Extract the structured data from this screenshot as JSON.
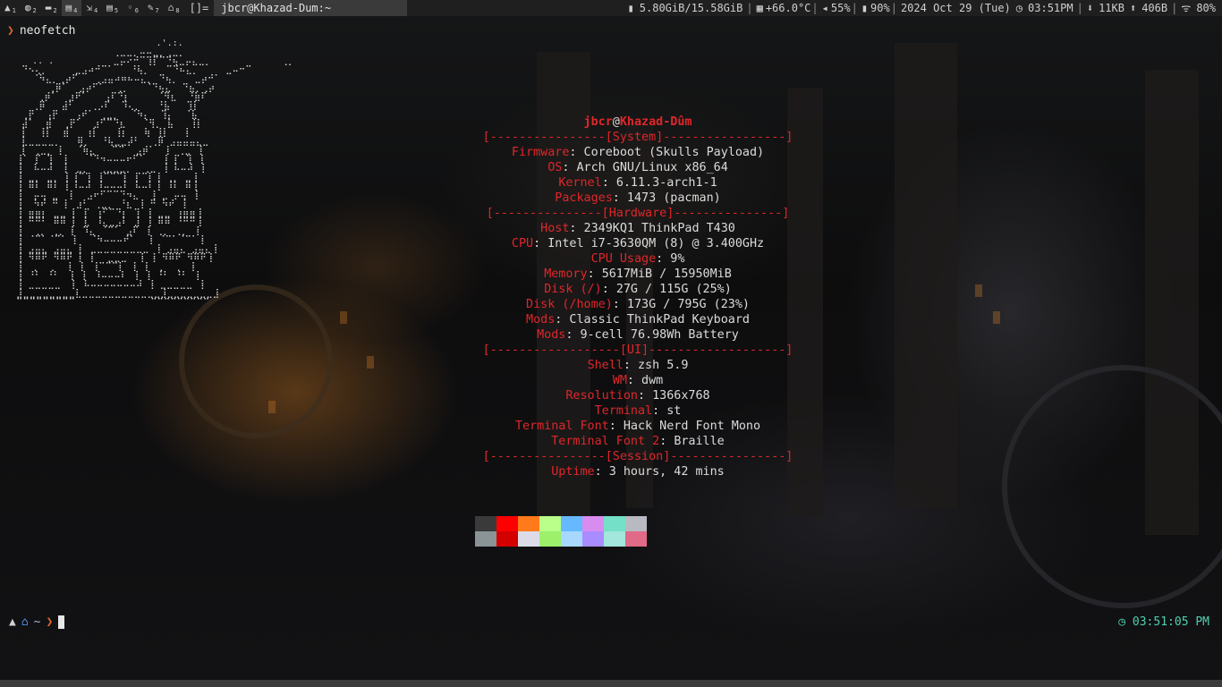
{
  "topbar": {
    "tags": [
      {
        "icon": "arch-icon",
        "glyph": "▲",
        "num": "1",
        "selected": false
      },
      {
        "icon": "globe-icon",
        "glyph": "◍",
        "num": "2",
        "selected": false
      },
      {
        "icon": "folder-icon",
        "glyph": "▬",
        "num": "2",
        "selected": false
      },
      {
        "icon": "files-icon",
        "glyph": "▤",
        "num": "4",
        "selected": true
      },
      {
        "icon": "code-icon",
        "glyph": "⇲",
        "num": "4",
        "selected": false
      },
      {
        "icon": "doc-icon",
        "glyph": "▤",
        "num": "5",
        "selected": false
      },
      {
        "icon": "circle-icon",
        "glyph": "◦",
        "num": "6",
        "selected": false
      },
      {
        "icon": "tools-icon",
        "glyph": "✎",
        "num": "7",
        "selected": false
      },
      {
        "icon": "flask-icon",
        "glyph": "⌂",
        "num": "8",
        "selected": false
      }
    ],
    "layout": "[]=",
    "window_title": "jbcr@Khazad-Dum:~",
    "status": {
      "memory": "5.80GiB/15.58GiB",
      "temp": "+66.0°C",
      "volume": "55%",
      "battery": "90%",
      "date": "2024 Oct 29 (Tue)",
      "time": "03:51PM",
      "download": "11KB",
      "upload": "406B",
      "wifi": "80%"
    }
  },
  "terminal": {
    "command": "neofetch",
    "ascii_art": "                           .'.:.\n                   ⢀⣀⣀⡀⠤⠤⣀⡀⢀⣀⡀\n    .. .           ⣀⡤⠔⠚⠉⢹⡏⠉⠙⢦⣀⡤⣄⣀⡀             ⢀⡀\n  ⠙⠢⢄⡀     ⣀⣠⠴⠚⠉⠁   ⠘⢧⡀   ⠉⠙⠦⣄⡀     ⣀⠤⠒⠉\n    ⠈⠳⣄⡀⢀⡴⠋   ⢀⣠⣤⠴⠶⠦⠤⣄⡀ ⠙⢦⡀   ⣀⡴⠚⠁\n       ⢀⡿⠁  ⣠⡴⠋⠁  ⢀⡀   ⠈⠙⢦⣄  ⠙⣦⡀⢀⡴\n     ⢀⡾⠁  ⣰⠟⠁   ⢠⠏⠙⡆     ⠈⠻⣆  ⠘⣷⠏\n    ⢀⡿   ⣼⠃   ⢀⡠⠏  ⠹⢄⡀   ⠘⣧   ⢹⡇\n  ⢀⡟  ⢠⡟   ⢠⠞⠁ ⢀⣀⡀  ⠈⠳⡄  ⢹⡄  ⠈⣧\n  ⣼⠁  ⣾  ⢀⡟⠁  ⣰⠋⠉⠙⣆   ⠈⢻⡀ ⣧   ⢸⡇\n  ⡇  ⢸⡇  ⣾   ⢰⡇   ⢸⡆   ⢷ ⢸⡇   ⡇\n  ⣇⣀⣀⣀⣀⡀   ⢿⡀  ⠘⢧⣀⣀⡼⠃  ⢀⡿ ⣠⣤⣤⣤⣄⣀\n  ⡇ ⢀⣀⡀ ⡇  ⠈⢷⣄   ⠉⠉  ⣠⡾⠁  ⡇ ⢀⣀ ⢸\n ⢸⠁ ⡏ ⢹  ⡇   ⠈⠙⠲⠤⠤⠤⠖⠋⠁   ⢸ ⡏ ⢹ ⢸\n ⢸  ⠧⠤⠼  ⡇ ⣀⡀  ⢀⣀⣀⣀⡀  ⢀⣀ ⢸ ⠧⠤⠼ ⢸\n ⢸ ⣀⡀ ⣀⡀ ⡇⢸⠉⢹ ⢸⠉⠉⠉⡇ ⡏⠉⡇⢸ ⢀⡀ ⣀⢸\n ⢸ ⠿⠇ ⠿⠇ ⡇⠸⠤⠼ ⠸⠤⠤⠤⠇ ⠧⠤⠇⢸ ⠸⠇ ⠿⢸\n ⢸  ⡤⢤ ⣀  ⡇  ⣠⠖⠋⠉⠉⠙⠲⣄  ⢸ ⣀ ⡤⢤ ⢸\n ⢸  ⠳⠞ ⠛ ⡇ ⣰⠃ ⢀⣀⡀ ⠘⣆ ⢸ ⠛ ⠳⠞ ⢸\n ⢸ ⣶⣶⡆ ⣀⣀ ⡇ ⡏ ⢰⠋⠉⠙⡆ ⢹ ⢸ ⣀⣀ ⢰⣶⣶⢸\n ⢸ ⠛⠛⠃ ⠿⠿ ⡇ ⣇ ⠸⣄⣀⣠⠇ ⣸ ⢸ ⠿⠿ ⠘⠛⠛⢸\n ⢸  ⢀⡀ ⢀⡀ ⡇ ⠹⣄ ⠈⠉⠁ ⣠⠏ ⢸ ⢀⡀ ⢀⡀ ⢸\n ⢸ ⠈⠉⠁⠈⠉⠁ ⡇  ⠈⠳⠤⠤⠤⠞⠁  ⢸ ⠈⠉⠁⠈⠉⠁⢸\n ⢸ ⣠⣤⣄ ⣠⣤⣄ ⡇ ⣀⣀⣀⣀⣀⣀⣀⣀⣀ ⢸ ⣠⣤⣄ ⣠⣤⣄⢸\n ⢸ ⠻⠿⠟ ⠻⠿⠟ ⡇ ⡇  ⣀⣀⣀  ⢸ ⢸ ⠻⠿⠟ ⠻⠿⠟⢸\n ⢸  ⡀  ⡀  ⡇ ⡇ ⢸⠉⠉⠉⡇ ⢸ ⢸  ⡀  ⡀ ⢸\n ⢸ ⠘⠃ ⠘⠃  ⡇ ⡇ ⠸⠤⠤⠤⠇ ⢸ ⢸ ⠘⠃ ⠘⠃ ⢸\n ⢸ ⣀⣀⣀⣀⣀  ⡇ ⠧⠤⠤⠤⠤⠤⠤⠤⠼ ⢸ ⣀⣀⣀⣀⣀ ⢸\n ⣸⣀⣀⣀⣀⣀⣀⣀⣀⣇⣀⣀⣀⣀⣀⣀⣀⣀⣀⣀⣀⣀⣸⣀⣀⣀⣀⣀⣀⣀⣸\n ⠉⠉⠉⠉⠉⠉⠉⠉⠉              ⠉⠉⠉⠉⠉⠉⠉⠉⠉",
    "info": {
      "user": "jbcr",
      "at": "@",
      "host": "Khazad-Dûm",
      "lines": [
        {
          "type": "sep",
          "text": "[----------------[System]-----------------]"
        },
        {
          "type": "kv",
          "key": "Firmware",
          "value": "Coreboot (Skulls Payload)"
        },
        {
          "type": "kv",
          "key": "OS",
          "value": "Arch GNU/Linux x86_64"
        },
        {
          "type": "kv",
          "key": "Kernel",
          "value": "6.11.3-arch1-1"
        },
        {
          "type": "kv",
          "key": "Packages",
          "value": "1473 (pacman)"
        },
        {
          "type": "sep",
          "text": "[---------------[Hardware]---------------]"
        },
        {
          "type": "kv",
          "key": "Host",
          "value": "2349KQ1 ThinkPad T430"
        },
        {
          "type": "kv",
          "key": "CPU",
          "value": "Intel i7-3630QM (8) @ 3.400GHz"
        },
        {
          "type": "kv",
          "key": "CPU Usage",
          "value": "9%"
        },
        {
          "type": "kv",
          "key": "Memory",
          "value": "5617MiB / 15950MiB"
        },
        {
          "type": "kv",
          "key": "Disk (/)",
          "value": "27G / 115G (25%)"
        },
        {
          "type": "kv",
          "key": "Disk (/home)",
          "value": "173G / 795G (23%)"
        },
        {
          "type": "kv",
          "key": "Mods",
          "value": "Classic ThinkPad Keyboard"
        },
        {
          "type": "kv",
          "key": "Mods",
          "value": "9-cell 76.98Wh Battery"
        },
        {
          "type": "sep",
          "text": "[------------------[UI]-------------------]"
        },
        {
          "type": "kv",
          "key": "Shell",
          "value": "zsh 5.9"
        },
        {
          "type": "kv",
          "key": "WM",
          "value": "dwm"
        },
        {
          "type": "kv",
          "key": "Resolution",
          "value": "1366x768"
        },
        {
          "type": "kv",
          "key": "Terminal",
          "value": "st"
        },
        {
          "type": "kv",
          "key": "Terminal Font",
          "value": "Hack Nerd Font Mono"
        },
        {
          "type": "kv",
          "key": "Terminal Font 2",
          "value": "Braille"
        },
        {
          "type": "sep",
          "text": "[----------------[Session]----------------]"
        },
        {
          "type": "kv",
          "key": "Uptime",
          "value": "3 hours, 42 mins"
        }
      ]
    },
    "palette": {
      "row1": [
        "#3a3a3a",
        "#ff0000",
        "#ff7a1a",
        "#b9ff8a",
        "#66b8ff",
        "#d98cf0",
        "#73e0c7",
        "#b9b9c2"
      ],
      "row2": [
        "#8a9496",
        "#d40000",
        "#dcdce8",
        "#9cf06a",
        "#a8d8ff",
        "#a98cff",
        "#a2e6dc",
        "#e06a87"
      ]
    },
    "prompt": {
      "home_glyph": "⌂",
      "dir": "~",
      "arrow": "❯"
    },
    "clock": "03:51:05 PM"
  }
}
